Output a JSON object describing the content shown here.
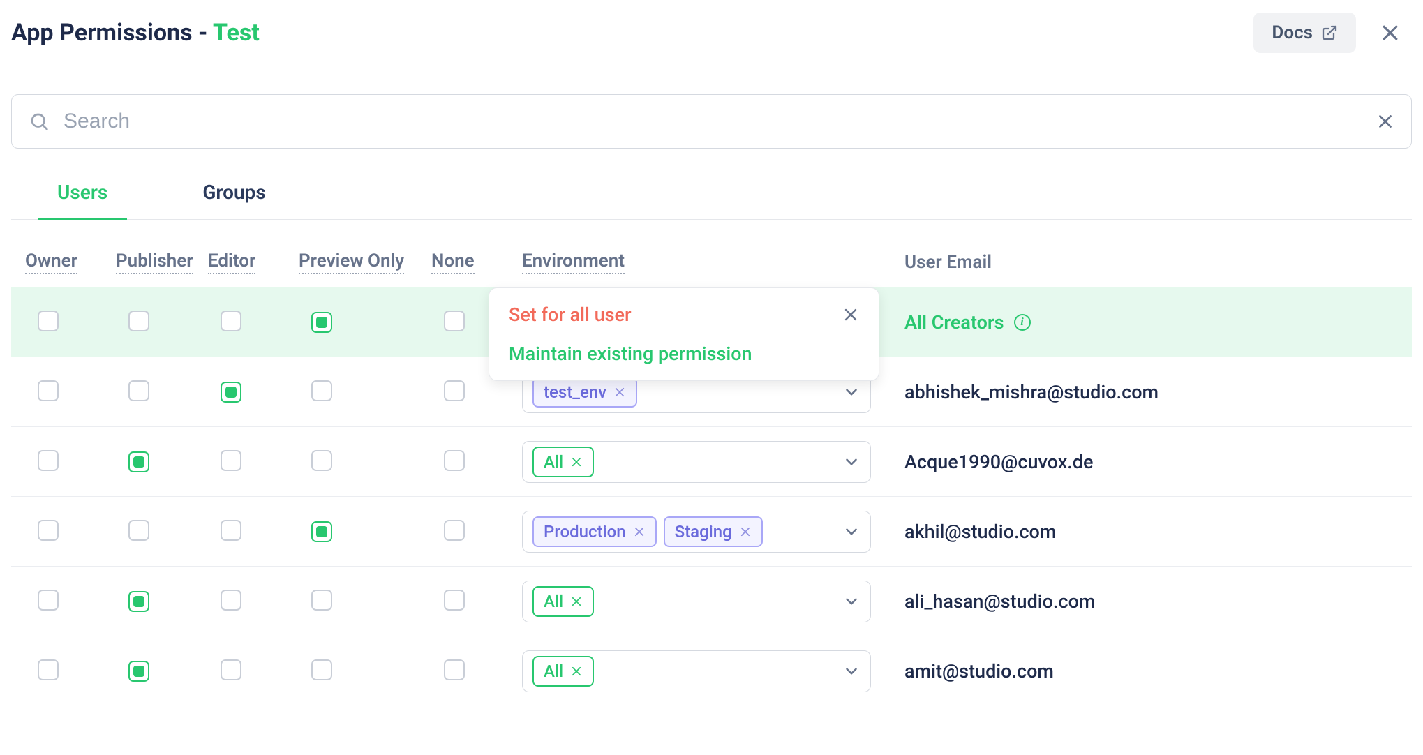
{
  "header": {
    "title_prefix": "App Permissions - ",
    "app_name": "Test",
    "docs_label": "Docs"
  },
  "search": {
    "placeholder": "Search"
  },
  "tabs": {
    "users": "Users",
    "groups": "Groups",
    "active": "users"
  },
  "columns": {
    "owner": "Owner",
    "publisher": "Publisher",
    "editor": "Editor",
    "preview_only": "Preview Only",
    "none": "None",
    "environment": "Environment",
    "user_email": "User Email"
  },
  "popover": {
    "option_set_all": "Set for all user",
    "option_maintain": "Maintain existing permission"
  },
  "rows": [
    {
      "highlight": true,
      "owner": false,
      "publisher": false,
      "editor": false,
      "preview_only": true,
      "none": false,
      "env_tags": [],
      "user_label": "All Creators",
      "user_is_all": true,
      "show_popover": true
    },
    {
      "highlight": false,
      "owner": false,
      "publisher": false,
      "editor": true,
      "preview_only": false,
      "none": false,
      "env_tags": [
        {
          "label": "test_env",
          "style": "purple"
        }
      ],
      "user_label": "abhishek_mishra@studio.com",
      "user_is_all": false
    },
    {
      "highlight": false,
      "owner": false,
      "publisher": true,
      "editor": false,
      "preview_only": false,
      "none": false,
      "env_tags": [
        {
          "label": "All",
          "style": "green"
        }
      ],
      "user_label": "Acque1990@cuvox.de",
      "user_is_all": false
    },
    {
      "highlight": false,
      "owner": false,
      "publisher": false,
      "editor": false,
      "preview_only": true,
      "none": false,
      "env_tags": [
        {
          "label": "Production",
          "style": "purple"
        },
        {
          "label": "Staging",
          "style": "purple"
        }
      ],
      "user_label": "akhil@studio.com",
      "user_is_all": false
    },
    {
      "highlight": false,
      "owner": false,
      "publisher": true,
      "editor": false,
      "preview_only": false,
      "none": false,
      "env_tags": [
        {
          "label": "All",
          "style": "green"
        }
      ],
      "user_label": "ali_hasan@studio.com",
      "user_is_all": false
    },
    {
      "highlight": false,
      "owner": false,
      "publisher": true,
      "editor": false,
      "preview_only": false,
      "none": false,
      "env_tags": [
        {
          "label": "All",
          "style": "green"
        }
      ],
      "user_label": "amit@studio.com",
      "user_is_all": false
    }
  ]
}
